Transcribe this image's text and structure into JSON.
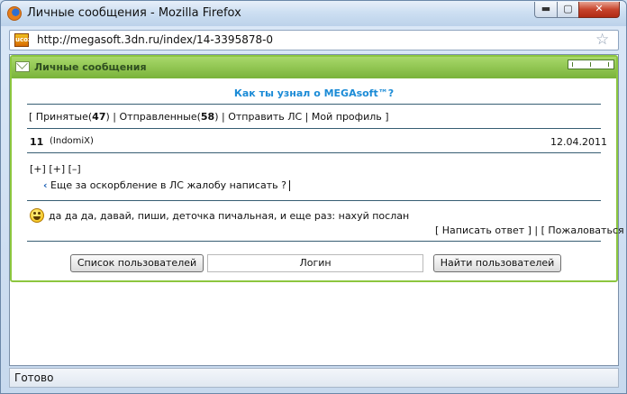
{
  "window": {
    "title": "Личные сообщения - Mozilla Firefox",
    "min_glyph": "▬",
    "max_glyph": "▢",
    "close_glyph": "✕"
  },
  "browser": {
    "url": "http://megasoft.3dn.ru/index/14-3395878-0",
    "site_icon_text": "ucoz",
    "status": "Готово"
  },
  "panel": {
    "title": "Личные сообщения",
    "promo_link": "Как ты узнал о MEGAsoft™?"
  },
  "nav": {
    "open_bracket": "[",
    "inbox_label": "Принятые(",
    "inbox_count": "47",
    "inbox_close": ")",
    "sep1": "|",
    "sent_label": "Отправленные(",
    "sent_count": "58",
    "sent_close": ")",
    "sep2": "|",
    "send_label": "Отправить ЛС",
    "sep3": "|",
    "profile_label": "Мой профиль",
    "close_bracket": "]"
  },
  "message": {
    "number": "11",
    "author": "(IndomiX)",
    "date": "12.04.2011",
    "controls": [
      "[+]",
      "[+]",
      "[–]"
    ],
    "quote_text": "Еще за оскорбление в ЛС жалобу написать ?",
    "reply_text": "да да да, давай, пиши, деточка пичальная, и еще раз: нахуй послан"
  },
  "actions": {
    "reply": "[ Написать ответ ]",
    "sep": "|",
    "complain": "[ Пожаловаться ]"
  },
  "footer": {
    "user_list_button": "Список пользователей",
    "login_value": "Логин",
    "find_button": "Найти пользователей"
  },
  "colors": {
    "panel_border": "#8cc63f",
    "promo": "#1b8bd6",
    "divider": "#375e73"
  },
  "icons": {
    "browser": "firefox-icon",
    "site": "site-favicon",
    "bookmark": "star-icon",
    "panel": "envelope-icon",
    "smiley": "smiley-icon"
  }
}
